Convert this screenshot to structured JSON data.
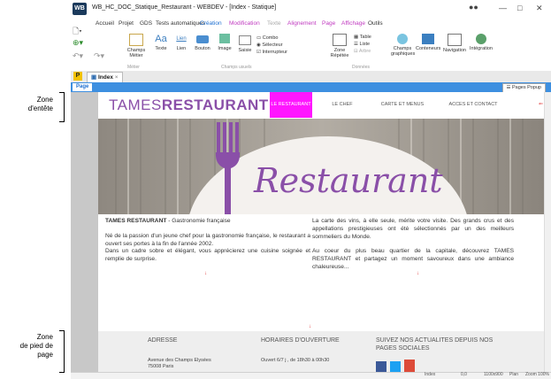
{
  "annotations": {
    "header_zone": "Zone\nd'entête",
    "footer_zone": "Zone\nde pied de\npage"
  },
  "app": {
    "logo_text": "WB",
    "title": "WB_HC_DOC_Statique_Restaurant - WEBDEV - [Index - Statique]",
    "menu": [
      "Accueil",
      "Projet",
      "GDS",
      "Tests automatiques",
      "Création",
      "Modification",
      "Texte",
      "Alignement",
      "Page",
      "Affichage",
      "Outils"
    ],
    "ribbon": {
      "champs_metier": "Champs Métier",
      "texte": "Texte",
      "lien": "Lien",
      "bouton": "Bouton",
      "image": "Image",
      "saisie": "Saisie",
      "combo": "Combo",
      "selecteur": "Sélecteur",
      "interrupteur": "Interrupteur",
      "zone_repetee": "Zone Répétée",
      "table": "Table",
      "liste": "Liste",
      "arbre": "Arbre",
      "champs_graphiques": "Champs graphiques",
      "conteneurs": "Conteneurs",
      "navigation": "Navigation",
      "integration": "Intégration",
      "group_metier": "Métier",
      "group_usuels": "Champs usuels",
      "group_donnees": "Données"
    },
    "doc_tab": "Index",
    "page_tab": "Page",
    "pages_popup": "Pages Popup"
  },
  "page": {
    "brand_light": "TAMES",
    "brand_bold": "RESTAURANT",
    "nav": [
      "LE RESTAURANT",
      "LE CHEF",
      "CARTE ET MENUS",
      "ACCES ET CONTACT"
    ],
    "hero_title": "Restaurant",
    "left": {
      "title_bold": "TAMES RESTAURANT",
      "title_rest": " - Gastronomie française",
      "p1": "Né de la passion d'un jeune chef pour la gastronomie française, le restaurant a ouvert ses portes à la fin de l'année 2002.",
      "p2": "Dans un cadre sobre et élégant, vous apprécierez une cuisine soignée et remplie de surprise."
    },
    "right": {
      "p1": "La carte des vins, à elle seule, mérite votre visite. Des grands crus et des appellations prestigieuses ont été sélectionnés par un des meilleurs sommeliers du Monde.",
      "p2": "Au coeur du plus beau quartier de la capitale, découvrez TAMES RESTAURANT et partagez un moment savoureux dans une ambiance chaleureuse..."
    },
    "footer": {
      "address_title": "ADRESSE",
      "address_line1": "Avenue des Champs Elysées",
      "address_line2": "75008 Paris",
      "hours_title": "HORAIRES D'OUVERTURE",
      "hours_line": "Ouvert 6/7 j , de 18h30 à 00h30",
      "social_title": "SUIVEZ NOS ACTUALITES DEPUIS NOS PAGES SOCIALES"
    }
  },
  "status": {
    "page_name": "Index",
    "coords": "0,0",
    "size": "1100x900",
    "mode": "Plan",
    "zoom": "Zoom 100%"
  },
  "colors": {
    "accent_magenta": "#ff16ff",
    "brand_purple": "#8a4fa8",
    "blue_bar": "#3d8fe0"
  }
}
